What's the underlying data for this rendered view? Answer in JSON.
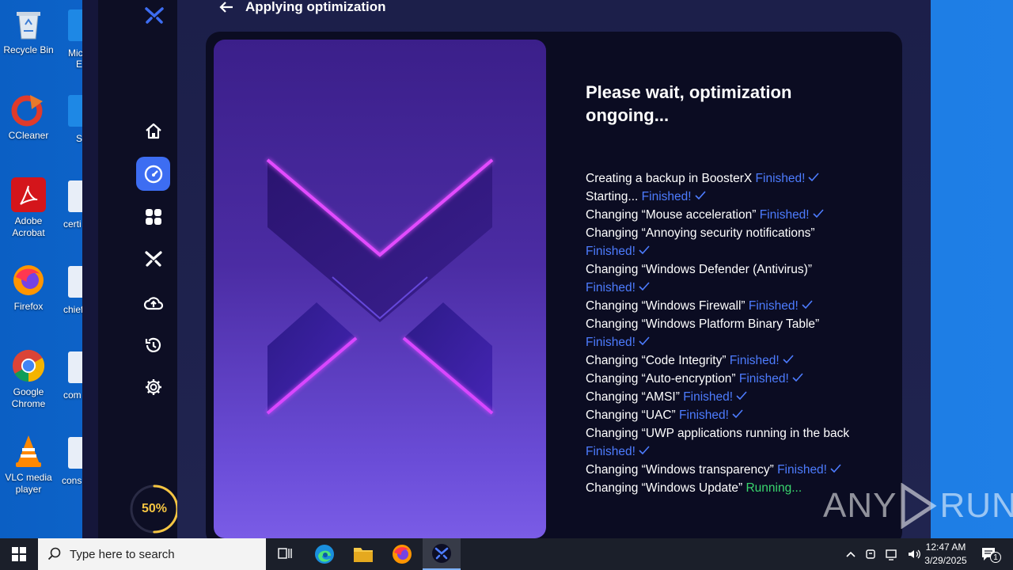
{
  "desktop": {
    "icons": [
      {
        "label": "Recycle Bin"
      },
      {
        "label": "CCleaner"
      },
      {
        "label": "Adobe Acrobat"
      },
      {
        "label": "Firefox"
      },
      {
        "label": "Google Chrome"
      },
      {
        "label": "VLC media player"
      }
    ],
    "partial_labels": [
      "Mic",
      "E",
      "S",
      "certi",
      "chief",
      "com",
      "cons"
    ]
  },
  "app": {
    "header_title": "Applying optimization",
    "progress_percent": "50%",
    "progress_value": 0.5,
    "optimization_title": "Please wait, optimization ongoing...",
    "log": [
      {
        "text": "Creating a backup in BoosterX",
        "status": "Finished!",
        "state": "finished"
      },
      {
        "text": "Starting...",
        "status": "Finished!",
        "state": "finished"
      },
      {
        "text": "Changing “Mouse acceleration”",
        "status": "Finished!",
        "state": "finished"
      },
      {
        "text": "Changing “Annoying security notifications”",
        "status": "",
        "state": "none"
      },
      {
        "text": "",
        "status": "Finished!",
        "state": "finished"
      },
      {
        "text": "Changing “Windows Defender (Antivirus)”",
        "status": "",
        "state": "none"
      },
      {
        "text": "",
        "status": "Finished!",
        "state": "finished"
      },
      {
        "text": "Changing “Windows Firewall”",
        "status": "Finished!",
        "state": "finished"
      },
      {
        "text": "Changing “Windows Platform Binary Table”",
        "status": "",
        "state": "none"
      },
      {
        "text": "",
        "status": "Finished!",
        "state": "finished"
      },
      {
        "text": "Changing “Code Integrity”",
        "status": "Finished!",
        "state": "finished"
      },
      {
        "text": "Changing “Auto-encryption”",
        "status": "Finished!",
        "state": "finished"
      },
      {
        "text": "Changing “AMSI”",
        "status": "Finished!",
        "state": "finished"
      },
      {
        "text": "Changing “UAC”",
        "status": "Finished!",
        "state": "finished"
      },
      {
        "text": "Changing “UWP applications running in the back",
        "status": "",
        "state": "none"
      },
      {
        "text": "",
        "status": "Finished!",
        "state": "finished"
      },
      {
        "text": "Changing “Windows transparency”",
        "status": "Finished!",
        "state": "finished"
      },
      {
        "text": "Changing “Windows Update”",
        "status": "Running...",
        "state": "running"
      }
    ],
    "sidebar_icons": [
      "home-icon",
      "speedometer-icon",
      "apps-grid-icon",
      "boosterx-icon",
      "cloud-upload-icon",
      "history-icon",
      "settings-icon"
    ]
  },
  "watermark": {
    "text_left": "ANY",
    "text_right": "RUN"
  },
  "taskbar": {
    "search_placeholder": "Type here to search",
    "time": "12:47 AM",
    "date": "3/29/2025",
    "notification_count": "1"
  },
  "colors": {
    "finished": "#4d7cff",
    "running": "#39d66e",
    "accent": "#3d6df2",
    "progress": "#f5c542"
  }
}
